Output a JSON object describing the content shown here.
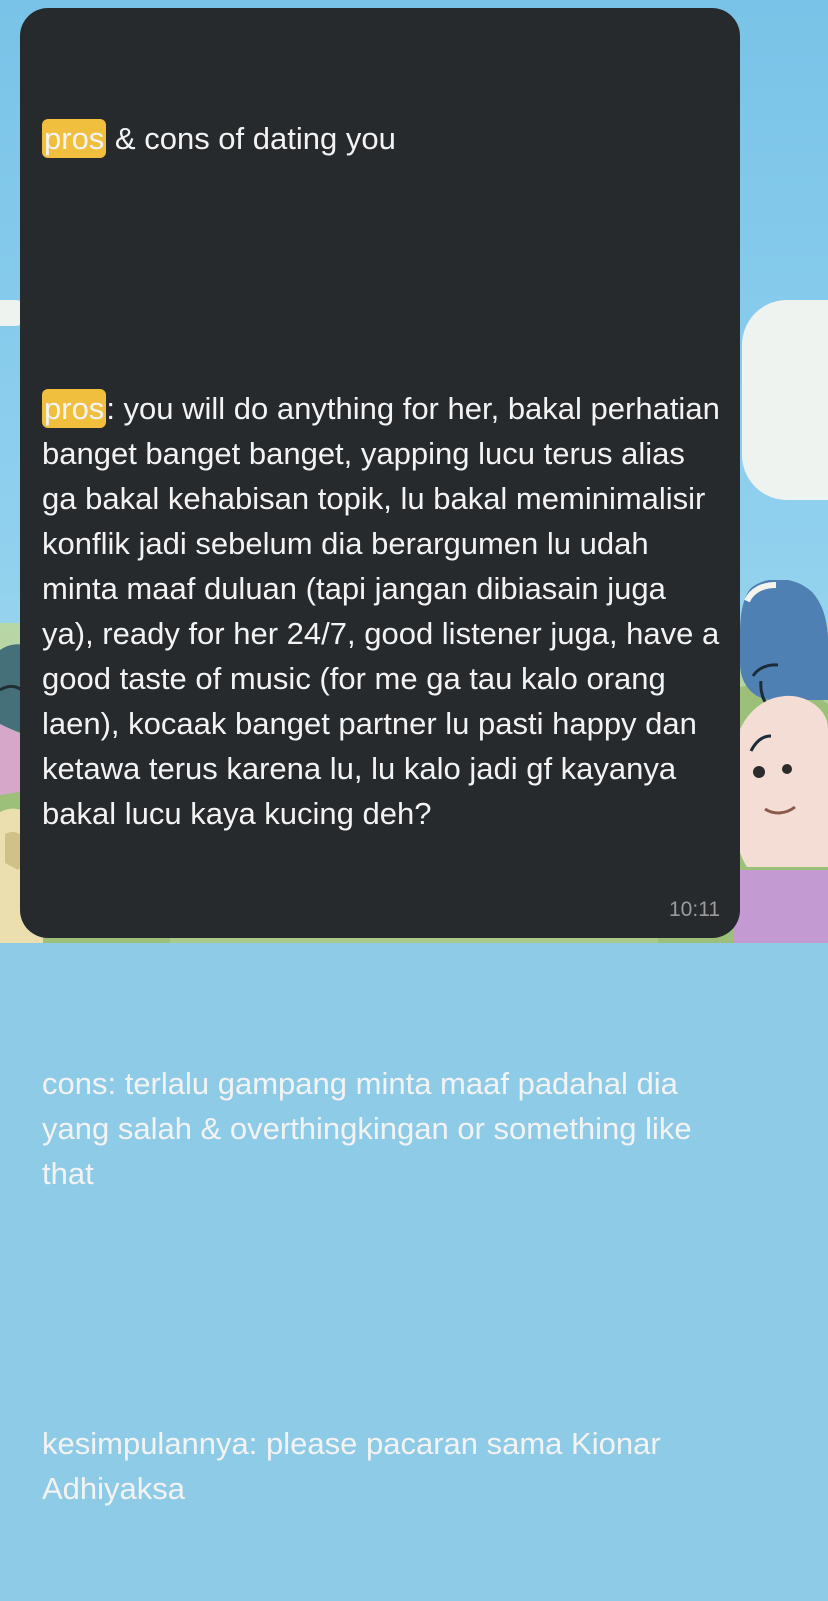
{
  "message": {
    "header": {
      "highlight": "pros",
      "rest": " & cons of dating you"
    },
    "pros": {
      "label": "pros",
      "text": ": you will do anything for her, bakal perhatian banget banget banget, yapping lucu terus alias ga bakal kehabisan topik, lu bakal meminimalisir konflik jadi sebelum dia berargumen lu udah minta maaf duluan (tapi jangan dibiasain juga ya), ready for her 24/7, good listener juga, have a good taste of music (for me ga tau kalo orang laen), kocaak banget partner lu pasti happy dan ketawa terus karena lu, lu kalo jadi gf kayanya bakal lucu kaya kucing deh?"
    },
    "cons": {
      "text": "cons: terlalu gampang minta maaf padahal dia yang salah & overthingkingan or something like that"
    },
    "conclusion": {
      "text": "kesimpulannya: please pacaran sama Kionar Adhiyaksa"
    },
    "time": "10:11"
  },
  "colors": {
    "bubble_background": "#272a2d",
    "highlight": "#f0bf3e",
    "text": "#f3f3f3",
    "timestamp": "#9b9b9b",
    "wallpaper_sky": "#8ecbe6",
    "wallpaper_grass": "#aac98a"
  },
  "icons": {
    "left_character": "cartoon-character-icon",
    "right_character": "cartoon-character-icon"
  }
}
